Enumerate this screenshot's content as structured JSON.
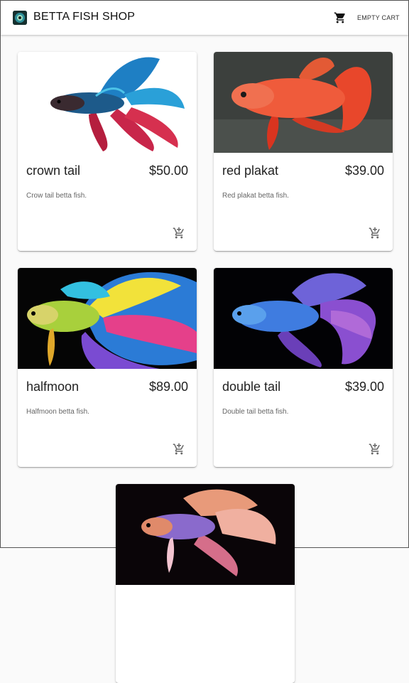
{
  "app": {
    "title": "BETTA FISH SHOP",
    "cart_icon": "shopping-cart-icon",
    "empty_cart_label": "EMPTY CART"
  },
  "products": [
    {
      "name": "crown tail",
      "price": "$50.00",
      "description": "Crow tail betta fish.",
      "image": "crown-tail-betta-image",
      "action_icon": "add-shopping-cart-icon"
    },
    {
      "name": "red plakat",
      "price": "$39.00",
      "description": "Red plakat betta fish.",
      "image": "red-plakat-betta-image",
      "action_icon": "add-shopping-cart-icon"
    },
    {
      "name": "halfmoon",
      "price": "$89.00",
      "description": "Halfmoon betta fish.",
      "image": "halfmoon-betta-image",
      "action_icon": "add-shopping-cart-icon"
    },
    {
      "name": "double tail",
      "price": "$39.00",
      "description": "Double tail betta fish.",
      "image": "double-tail-betta-image",
      "action_icon": "add-shopping-cart-icon"
    },
    {
      "image": "betta-fish-image"
    }
  ],
  "colors": {
    "appbar": "#ffffff",
    "page_background": "#fafafa",
    "card": "#ffffff"
  }
}
